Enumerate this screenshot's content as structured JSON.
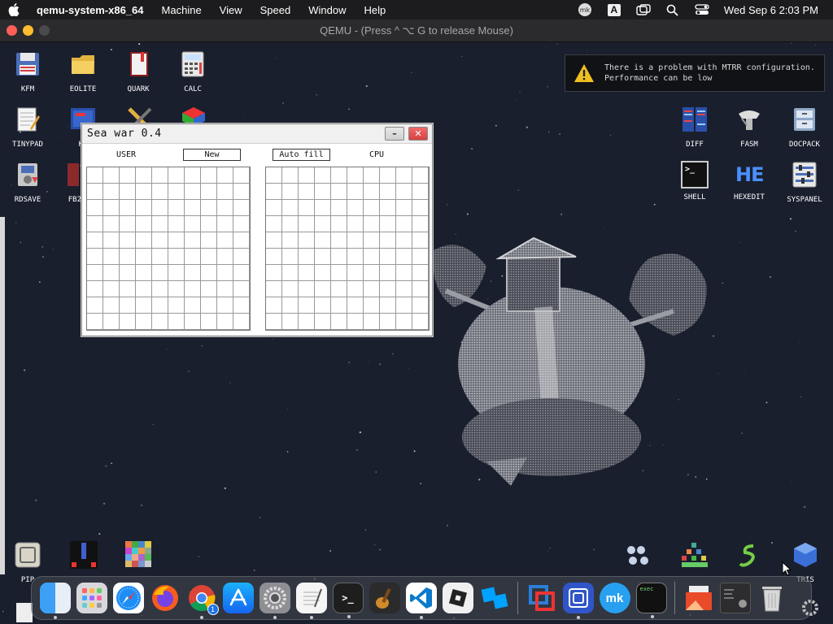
{
  "menubar": {
    "app_name": "qemu-system-x86_64",
    "menus": [
      "Machine",
      "View",
      "Speed",
      "Window",
      "Help"
    ],
    "status_icons": [
      "mk-icon",
      "input-source-A-icon",
      "window-icon",
      "search-icon",
      "control-center-icon"
    ],
    "input_source_label": "A",
    "clock": "Wed Sep 6  2:03 PM"
  },
  "qemu_window": {
    "title": "QEMU - (Press  ^ ⌥ G  to release Mouse)"
  },
  "desktop": {
    "icons": [
      {
        "label": "KFM",
        "icon": "floppy-disk-icon"
      },
      {
        "label": "EOLITE",
        "icon": "folder-icon"
      },
      {
        "label": "QUARK",
        "icon": "notebook-icon"
      },
      {
        "label": "CALC",
        "icon": "calculator-icon"
      },
      {
        "label": "TINYPAD",
        "icon": "notepad-icon"
      },
      {
        "label": "KF",
        "icon": "monitor-icon"
      },
      {
        "label": "RDSAVE",
        "icon": "disk-save-icon"
      },
      {
        "label": "FB2",
        "icon": "book-icon"
      },
      {
        "label": "DIFF",
        "icon": "diff-icon"
      },
      {
        "label": "FASM",
        "icon": "fasm-icon"
      },
      {
        "label": "DOCPACK",
        "icon": "docpack-icon"
      },
      {
        "label": "SHELL",
        "icon": "shell-icon"
      },
      {
        "label": "HEXEDIT",
        "icon": "hexedit-icon"
      },
      {
        "label": "SYSPANEL",
        "icon": "syspanel-icon"
      },
      {
        "label": "PIP",
        "icon": "pip-icon"
      },
      {
        "label": "TRIS",
        "icon": "tetris-icon"
      }
    ],
    "hexedit_glyph": "HE",
    "shell_glyph": ">_"
  },
  "notification": {
    "line1": "There is a problem with MTRR configuration.",
    "line2": "Performance can be low"
  },
  "seawar": {
    "title": "Sea war 0.4",
    "minimize_glyph": "–",
    "close_glyph": "✕",
    "user_label": "USER",
    "new_button": "New",
    "autofill_button": "Auto fill",
    "cpu_label": "CPU"
  },
  "dock": {
    "apps": [
      "finder-icon",
      "launchpad-icon",
      "safari-icon",
      "firefox-icon",
      "chrome-icon",
      "app-store-icon",
      "system-settings-icon",
      "textedit-icon",
      "terminal-icon",
      "garageband-icon",
      "vscode-icon",
      "roblox-icon",
      "roblox-studio-icon",
      "parallels-icon",
      "qemu-icon",
      "mk-icon",
      "console-icon",
      "preview-icon",
      "window-preview-icon",
      "trash-icon"
    ],
    "chrome_badge": "1"
  }
}
